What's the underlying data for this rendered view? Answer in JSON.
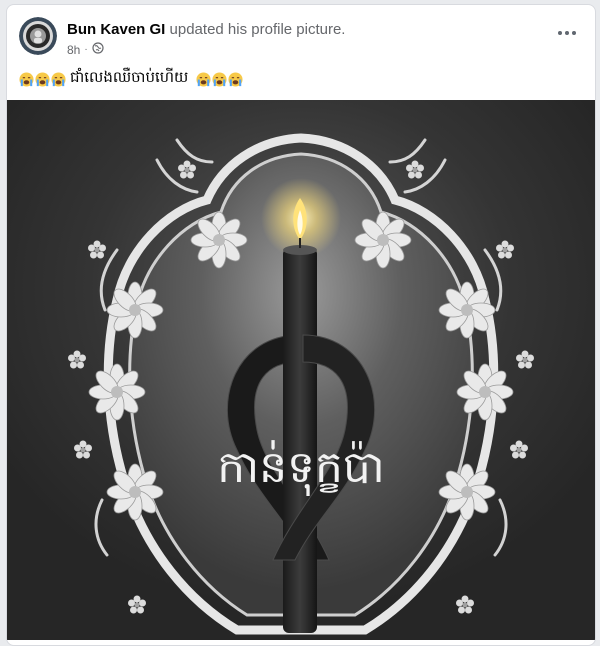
{
  "post": {
    "author": "Bun Kaven GI",
    "action": "updated his profile picture.",
    "time": "8h",
    "audience_icon": "globe-icon",
    "more_icon": "more-options-icon",
    "caption_emoji": "crying-face-emoji",
    "caption_text": "ជាំលេងឈឺចាប់ហើយ"
  },
  "image": {
    "overlay_text": "កាន់ទុក្ខប៉ា",
    "subject": "candle-with-black-mourning-ribbon",
    "frame": "white-floral-ornamental-frame"
  },
  "colors": {
    "background": "#2e2e2e",
    "flame": "#ffe27a",
    "ribbon": "#1a1a1a",
    "frame": "#e6e6e6"
  }
}
